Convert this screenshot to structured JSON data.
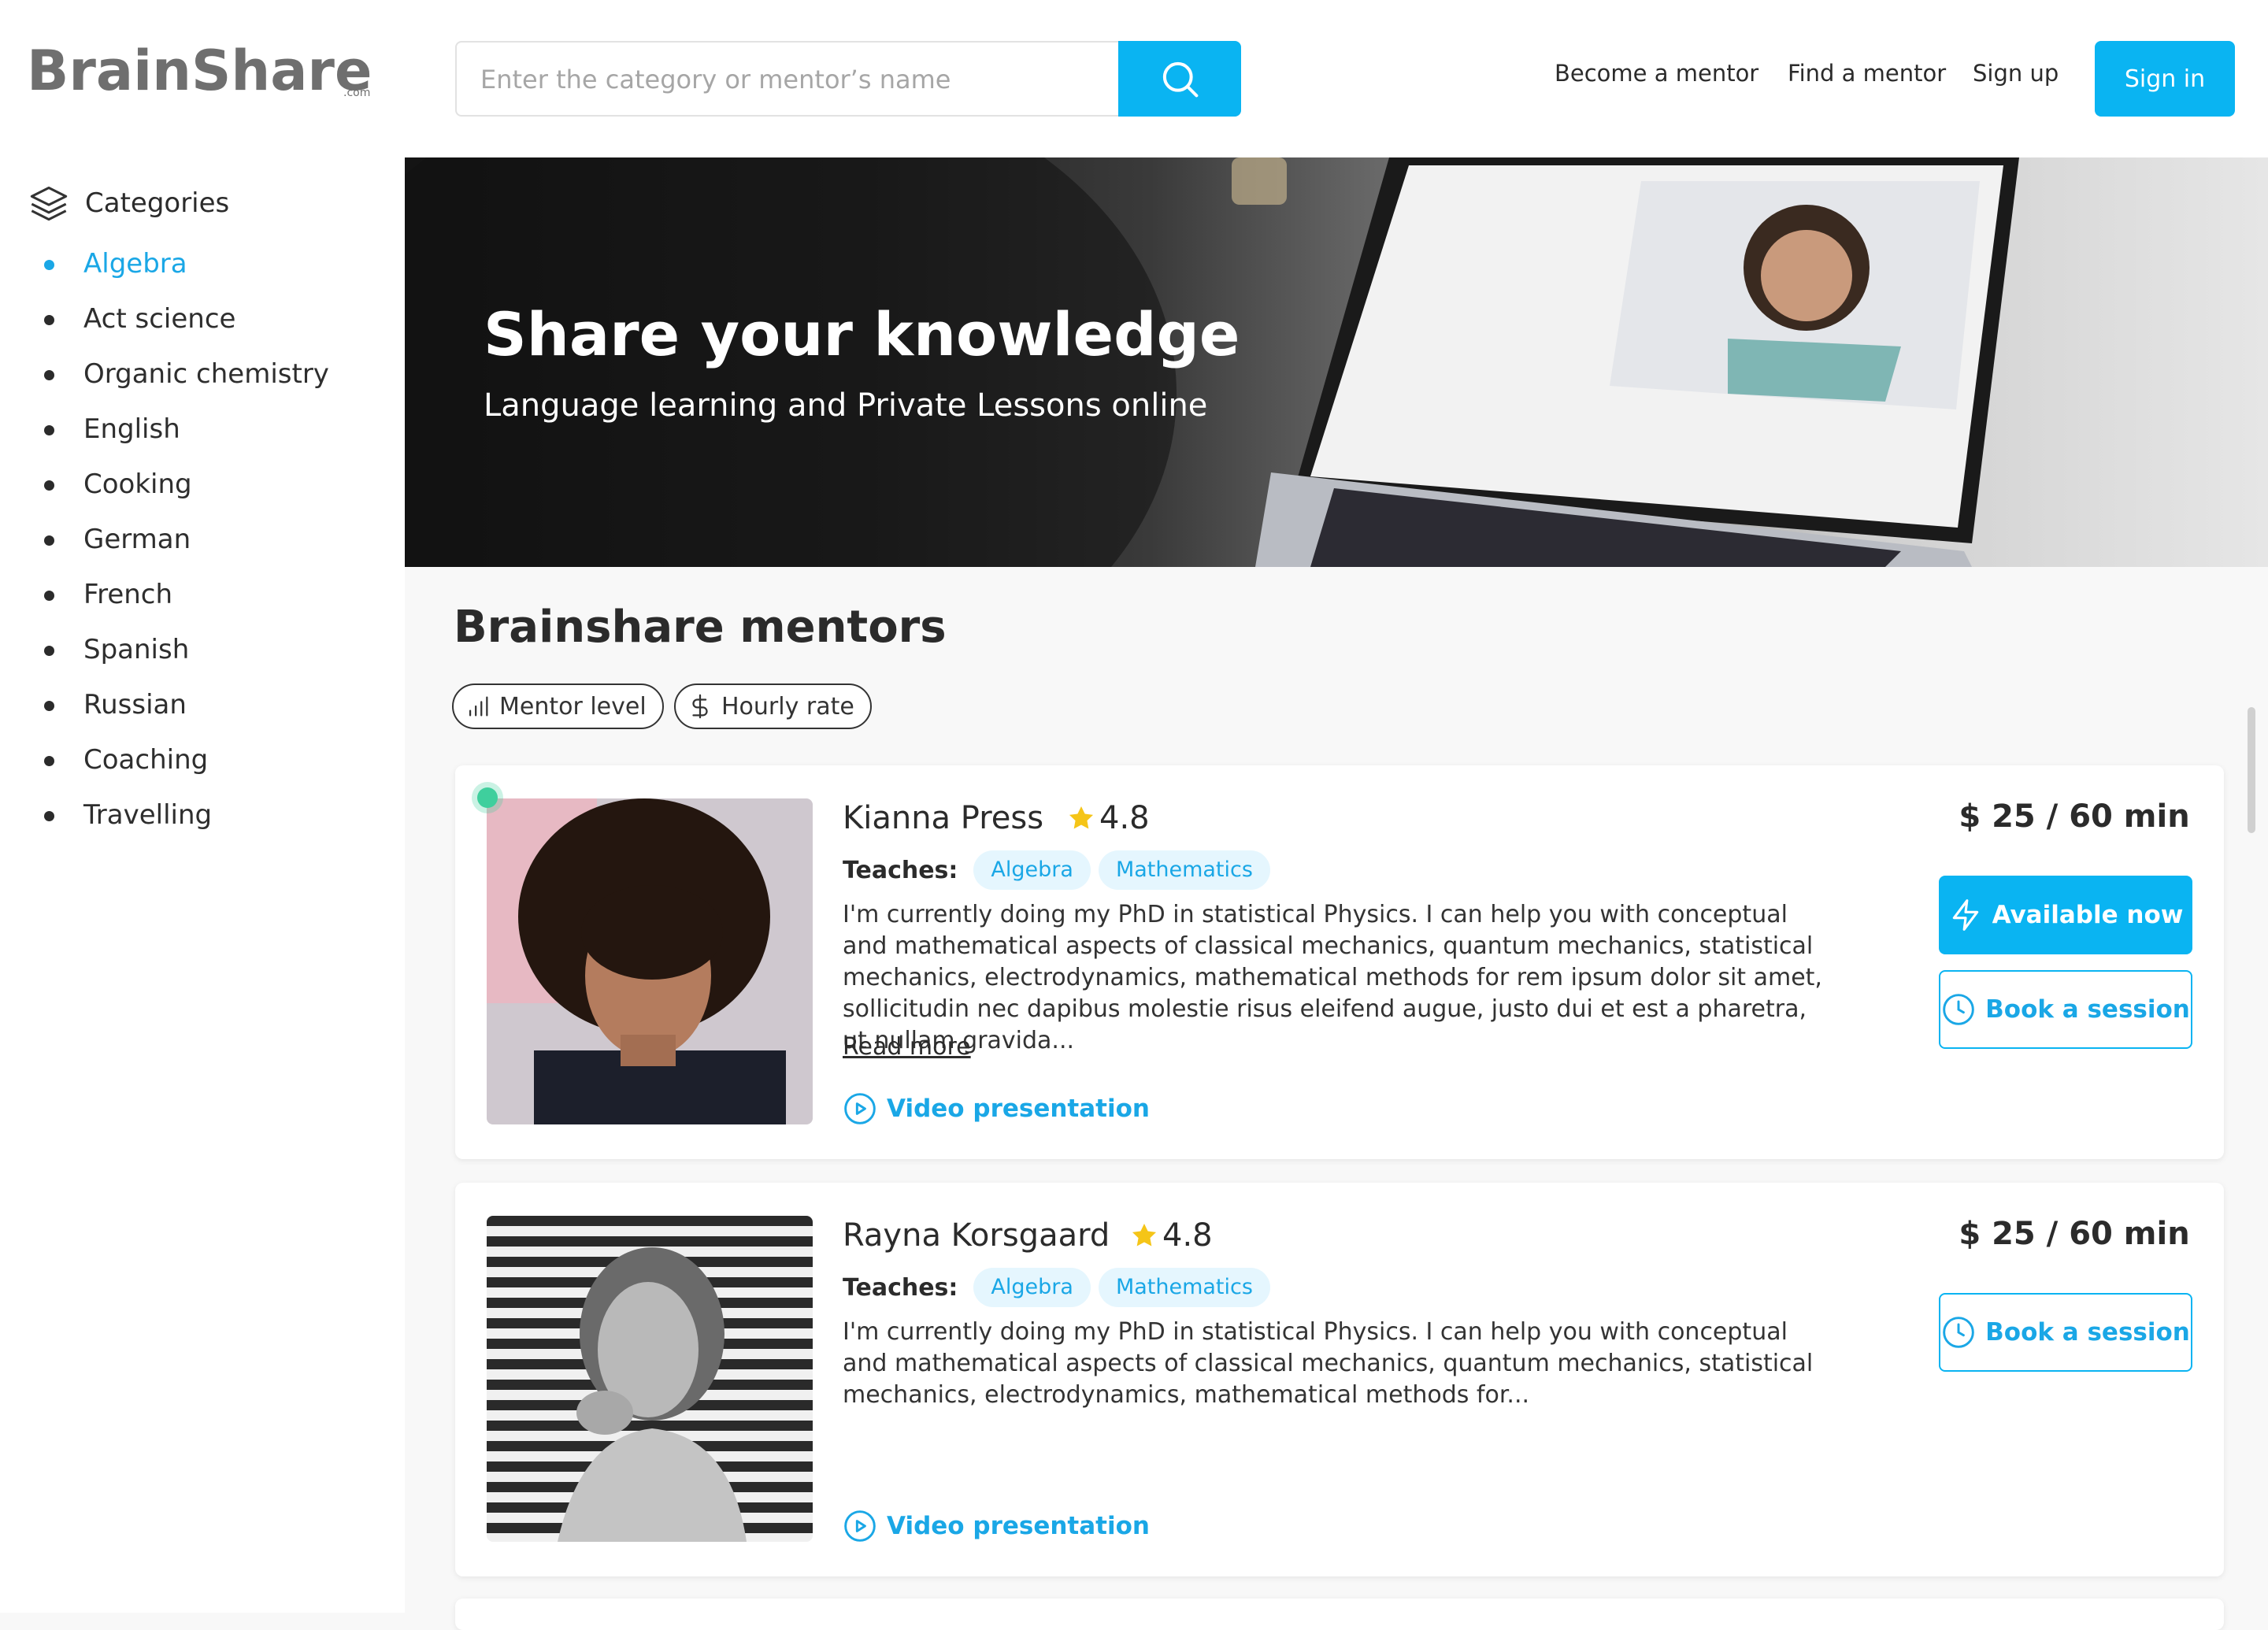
{
  "brand": {
    "logo_text": "BrainShare",
    "logo_suffix": ".com"
  },
  "search": {
    "placeholder": "Enter the category or mentor’s name"
  },
  "nav": {
    "become_mentor": "Become a mentor",
    "find_mentor": "Find a mentor",
    "sign_up": "Sign up",
    "sign_in": "Sign in"
  },
  "sidebar": {
    "heading": "Categories",
    "items": [
      {
        "label": "Algebra",
        "active": true
      },
      {
        "label": "Act science"
      },
      {
        "label": "Organic chemistry"
      },
      {
        "label": "English"
      },
      {
        "label": "Cooking"
      },
      {
        "label": "German"
      },
      {
        "label": "French"
      },
      {
        "label": "Spanish"
      },
      {
        "label": "Russian"
      },
      {
        "label": "Coaching"
      },
      {
        "label": "Travelling"
      }
    ]
  },
  "hero": {
    "title": "Share your knowledge",
    "subtitle": "Language learning and Private Lessons online"
  },
  "main": {
    "title": "Brainshare mentors",
    "filters": [
      {
        "label": "Mentor level",
        "icon": "bar-chart-icon"
      },
      {
        "label": "Hourly rate",
        "icon": "dollar-icon"
      }
    ]
  },
  "mentors": [
    {
      "name": "Kianna Press",
      "rating": "4.8",
      "online": true,
      "teaches_label": "Teaches:",
      "tags": [
        "Algebra",
        "Mathematics"
      ],
      "description": "I'm currently doing my PhD in statistical Physics. I can help you with conceptual and mathematical aspects of classical mechanics, quantum mechanics, statistical mechanics, electrodynamics, mathematical methods for rem ipsum dolor sit amet, sollicitudin nec dapibus molestie risus eleifend augue, justo dui et est a pharetra, ut nullam gravida...",
      "read_more": "Read more",
      "video_label": "Video presentation",
      "price": "$ 25 / 60 min",
      "available_label": "Available now",
      "book_label": "Book a session"
    },
    {
      "name": "Rayna Korsgaard",
      "rating": "4.8",
      "online": false,
      "teaches_label": "Teaches:",
      "tags": [
        "Algebra",
        "Mathematics"
      ],
      "description": "I'm currently doing my PhD in statistical Physics. I can help you with conceptual and mathematical aspects of classical mechanics, quantum mechanics, statistical mechanics, electrodynamics, mathematical methods for...",
      "video_label": "Video presentation",
      "price": "$ 25 / 60 min",
      "book_label": "Book a session"
    }
  ],
  "colors": {
    "accent": "#0ab4f2",
    "accent_text": "#1aa7e6",
    "online": "#3fcf9d",
    "star": "#f5c518"
  }
}
